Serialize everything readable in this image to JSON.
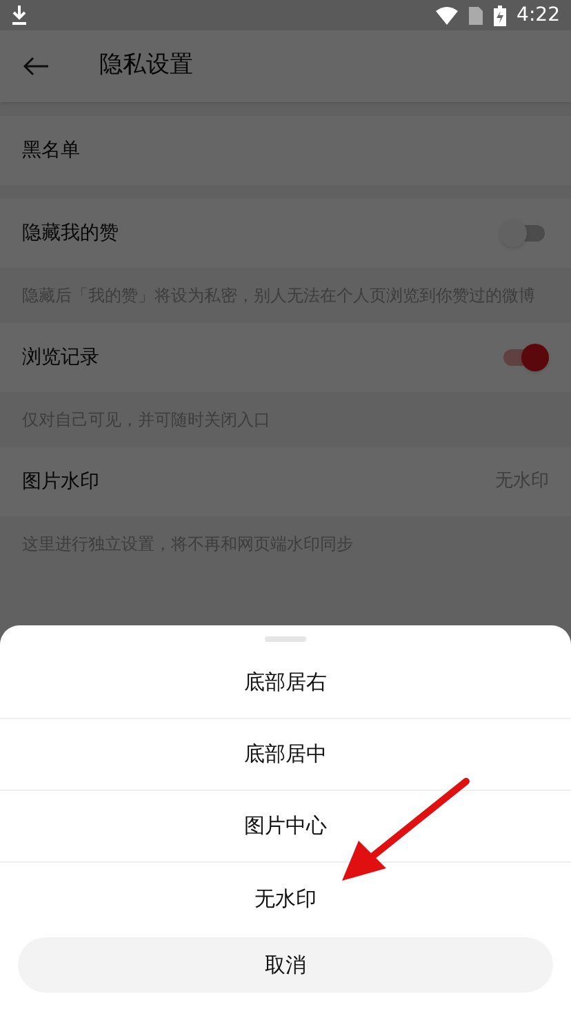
{
  "status_bar": {
    "time": "4:22"
  },
  "header": {
    "title": "隐私设置"
  },
  "sections": [
    {
      "kind": "link",
      "label": "黑名单"
    },
    {
      "kind": "switch",
      "label": "隐藏我的赞",
      "on": false,
      "note": "隐藏后「我的赞」将设为私密，别人无法在个人页浏览到你赞过的微博"
    },
    {
      "kind": "switch",
      "label": "浏览记录",
      "on": true,
      "note": "仅对自己可见，并可随时关闭入口"
    },
    {
      "kind": "value",
      "label": "图片水印",
      "value": "无水印",
      "note": "这里进行独立设置，将不再和网页端水印同步"
    }
  ],
  "sheet": {
    "options": [
      "底部居右",
      "底部居中",
      "图片中心",
      "无水印"
    ],
    "cancel": "取消"
  }
}
